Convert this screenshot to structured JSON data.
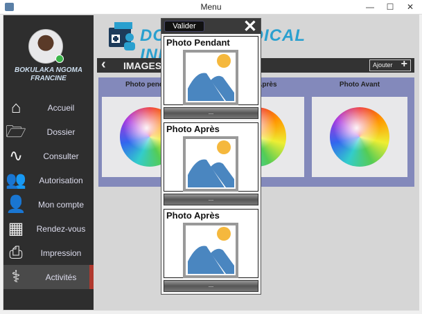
{
  "window": {
    "title": "Menu",
    "controls": [
      "—",
      "☐",
      "✕"
    ]
  },
  "user": {
    "name": "BOKULAKA NGOMA FRANCINE",
    "status_color": "#3bb54a"
  },
  "nav": [
    {
      "label": "Accueil",
      "icon": "home-icon",
      "glyph": "⌂"
    },
    {
      "label": "Dossier",
      "icon": "folder-icon",
      "glyph": "🗁"
    },
    {
      "label": "Consulter",
      "icon": "stethoscope-icon",
      "glyph": "∿"
    },
    {
      "label": "Autorisation",
      "icon": "users-icon",
      "glyph": "👥"
    },
    {
      "label": "Mon compte",
      "icon": "user-icon",
      "glyph": "👤"
    },
    {
      "label": "Rendez-vous",
      "icon": "calendar-icon",
      "glyph": "▦"
    },
    {
      "label": "Impression",
      "icon": "printer-icon",
      "glyph": "⎙"
    },
    {
      "label": "Activités",
      "icon": "caduceus-icon",
      "glyph": "⚕",
      "selected": true
    }
  ],
  "app_title": "DOSSIER MEDICAL INFORMATISE",
  "header": {
    "back": "‹",
    "title": "IMAGES",
    "add_label": "Ajouter",
    "add_glyph": "+"
  },
  "cards": [
    {
      "title": "Photo pendant"
    },
    {
      "title": "Photo Après"
    },
    {
      "title": "Photo Avant"
    }
  ],
  "popup": {
    "validate_label": "Valider",
    "close": "✕",
    "items": [
      {
        "title": "Photo Pendant",
        "button": "..."
      },
      {
        "title": "Photo Après",
        "button": "..."
      },
      {
        "title": "Photo Après",
        "button": "..."
      }
    ]
  },
  "colors": {
    "accent": "#2aa0cf",
    "selected": "#b0392e",
    "panel": "#8389bb"
  }
}
